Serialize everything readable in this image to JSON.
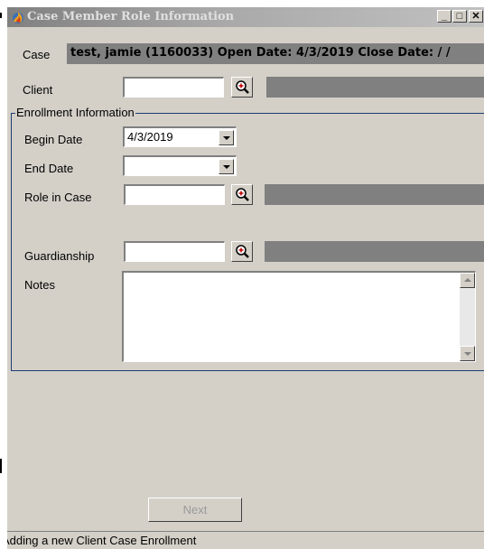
{
  "window": {
    "title": "Case Member Role Information",
    "controls": {
      "minimize": "_",
      "maximize": "□",
      "close": "✕"
    }
  },
  "case": {
    "label": "Case",
    "value": "test, jamie (1160033) Open Date: 4/3/2019 Close Date:  /  /"
  },
  "client": {
    "label": "Client",
    "value": ""
  },
  "enrollment": {
    "group_label": "Enrollment Information",
    "begin_date": {
      "label": "Begin Date",
      "value": "4/3/2019"
    },
    "end_date": {
      "label": "End Date",
      "value": ""
    },
    "role_in_case": {
      "label": "Role in Case",
      "value": ""
    },
    "guardianship": {
      "label": "Guardianship",
      "value": ""
    },
    "notes": {
      "label": "Notes",
      "value": ""
    }
  },
  "buttons": {
    "next": "Next"
  },
  "status_bar": {
    "text": "Adding a new Client Case Enrollment"
  },
  "colors": {
    "title_bar": "#a9a9a9",
    "panel": "#d4d0c8",
    "readonly_box": "#808080",
    "group_border": "#1f3c73"
  },
  "icons": {
    "app": "flame-icon",
    "lookup": "magnifier-icon"
  }
}
